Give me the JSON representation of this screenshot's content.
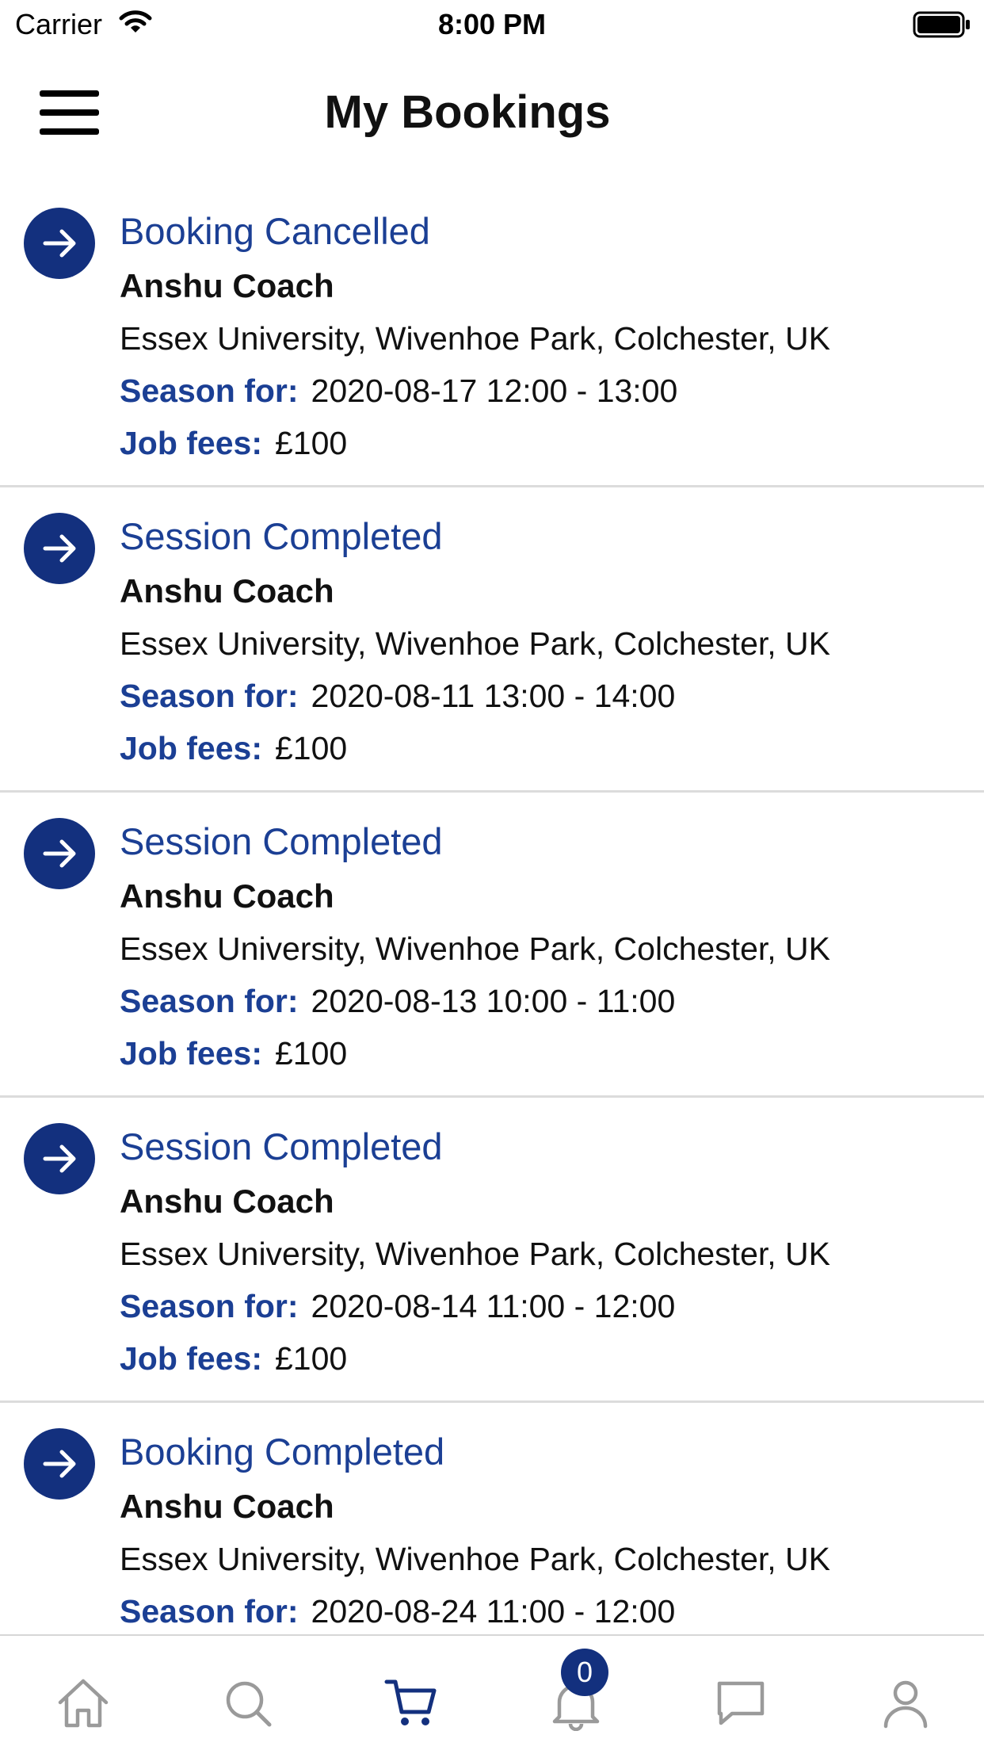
{
  "status_bar": {
    "carrier": "Carrier",
    "time": "8:00 PM"
  },
  "header": {
    "title": "My Bookings"
  },
  "bookings": [
    {
      "status": "Booking Cancelled",
      "coach": "Anshu Coach",
      "address": "Essex University, Wivenhoe Park, Colchester, UK",
      "season_label": "Season for:",
      "season": "2020-08-17 12:00 - 13:00",
      "fees_label": "Job fees:",
      "fees": "£100"
    },
    {
      "status": "Session Completed",
      "coach": "Anshu Coach",
      "address": "Essex University, Wivenhoe Park, Colchester, UK",
      "season_label": "Season for:",
      "season": "2020-08-11 13:00 - 14:00",
      "fees_label": "Job fees:",
      "fees": "£100"
    },
    {
      "status": "Session Completed",
      "coach": "Anshu Coach",
      "address": "Essex University, Wivenhoe Park, Colchester, UK",
      "season_label": "Season for:",
      "season": "2020-08-13 10:00 - 11:00",
      "fees_label": "Job fees:",
      "fees": "£100"
    },
    {
      "status": "Session Completed",
      "coach": "Anshu Coach",
      "address": "Essex University, Wivenhoe Park, Colchester, UK",
      "season_label": "Season for:",
      "season": "2020-08-14 11:00 - 12:00",
      "fees_label": "Job fees:",
      "fees": "£100"
    },
    {
      "status": "Booking Completed",
      "coach": "Anshu Coach",
      "address": "Essex University, Wivenhoe Park, Colchester, UK",
      "season_label": "Season for:",
      "season": "2020-08-24 11:00 - 12:00"
    }
  ],
  "tabbar": {
    "tabs": [
      {
        "icon": "home-icon",
        "active": false
      },
      {
        "icon": "search-icon",
        "active": false
      },
      {
        "icon": "cart-icon",
        "active": true
      },
      {
        "icon": "bell-icon",
        "active": false
      },
      {
        "icon": "chat-icon",
        "active": false
      },
      {
        "icon": "profile-icon",
        "active": false
      }
    ],
    "notification_count": "0"
  },
  "colors": {
    "accent": "#13307e",
    "accent_text": "#1b3f94",
    "inactive_icon": "#9a9a9a",
    "divider": "#dcdcdc"
  }
}
